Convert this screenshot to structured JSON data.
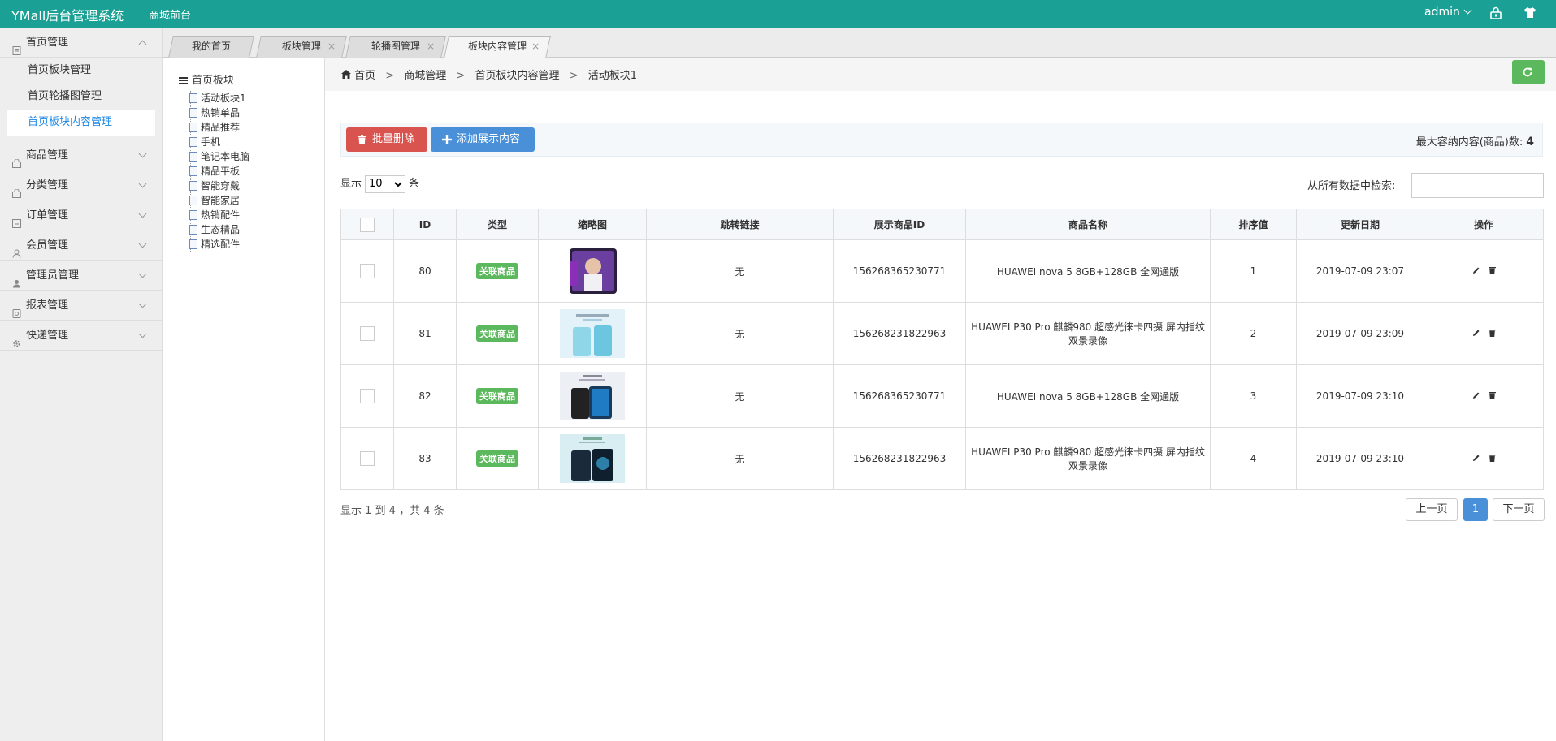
{
  "header": {
    "brand": "YMall后台管理系统",
    "front_link": "商城前台",
    "user": "admin"
  },
  "sidebar": {
    "groups": [
      {
        "label": "首页管理",
        "open": true,
        "items": [
          {
            "label": "首页板块管理"
          },
          {
            "label": "首页轮播图管理"
          },
          {
            "label": "首页板块内容管理",
            "active": true
          }
        ]
      },
      {
        "label": "商品管理"
      },
      {
        "label": "分类管理"
      },
      {
        "label": "订单管理"
      },
      {
        "label": "会员管理"
      },
      {
        "label": "管理员管理"
      },
      {
        "label": "报表管理"
      },
      {
        "label": "快递管理"
      }
    ]
  },
  "tabs": [
    {
      "label": "我的首页"
    },
    {
      "label": "板块管理"
    },
    {
      "label": "轮播图管理"
    },
    {
      "label": "板块内容管理",
      "active": true
    }
  ],
  "tree": {
    "root": "首页板块",
    "items": [
      "活动板块1",
      "热销单品",
      "精品推荐",
      "手机",
      "笔记本电脑",
      "精品平板",
      "智能穿戴",
      "智能家居",
      "热销配件",
      "生态精品",
      "精选配件"
    ]
  },
  "breadcrumb": {
    "home": "首页",
    "level1": "商城管理",
    "level2": "首页板块内容管理",
    "level3": "活动板块1",
    "sep": ">"
  },
  "toolbar": {
    "delete_label": "批量删除",
    "add_label": "添加展示内容",
    "max_label": "最大容纳内容(商品)数:",
    "max_value": "4"
  },
  "list": {
    "show_prefix": "显示",
    "page_size": "10",
    "show_suffix": "条",
    "search_label": "从所有数据中检索:"
  },
  "table": {
    "headers": [
      "",
      "ID",
      "类型",
      "缩略图",
      "跳转链接",
      "展示商品ID",
      "商品名称",
      "排序值",
      "更新日期",
      "操作"
    ],
    "rows": [
      {
        "id": "80",
        "type": "关联商品",
        "link": "无",
        "product_id": "156268365230771",
        "name": "HUAWEI nova 5 8GB+128GB 全网通版",
        "sort": "1",
        "date": "2019-07-09 23:07"
      },
      {
        "id": "81",
        "type": "关联商品",
        "link": "无",
        "product_id": "156268231822963",
        "name": "HUAWEI P30 Pro 麒麟980 超感光徕卡四摄 屏内指纹 双景录像",
        "sort": "2",
        "date": "2019-07-09 23:09"
      },
      {
        "id": "82",
        "type": "关联商品",
        "link": "无",
        "product_id": "156268365230771",
        "name": "HUAWEI nova 5 8GB+128GB 全网通版",
        "sort": "3",
        "date": "2019-07-09 23:10"
      },
      {
        "id": "83",
        "type": "关联商品",
        "link": "无",
        "product_id": "156268231822963",
        "name": "HUAWEI P30 Pro 麒麟980 超感光徕卡四摄 屏内指纹 双景录像",
        "sort": "4",
        "date": "2019-07-09 23:10"
      }
    ]
  },
  "pagination": {
    "summary": "显示 1 到 4 ，共 4 条",
    "prev": "上一页",
    "current": "1",
    "next": "下一页"
  },
  "colors": {
    "header": "#1aa094",
    "active": "#1e88e5",
    "danger": "#d9534f",
    "primary": "#4a90d9",
    "success": "#5cb85c"
  },
  "icons": [
    "lock-icon",
    "shirt-icon",
    "refresh-icon",
    "trash-icon",
    "plus-icon",
    "edit-icon",
    "home-icon",
    "list-icon",
    "document-icon"
  ]
}
